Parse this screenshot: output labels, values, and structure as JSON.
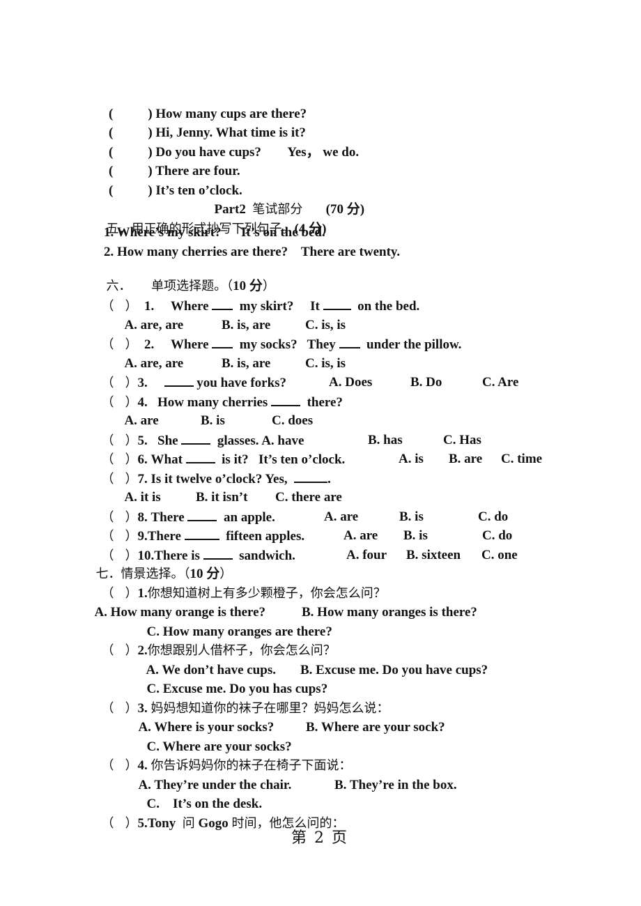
{
  "listening_tail": [
    "How many cups are there?",
    "Hi, Jenny. What time is it?",
    "Do you have cups?        Yes， we do.",
    "There are four.",
    "It’s ten o’clock."
  ],
  "part2": {
    "title": "Part2",
    "cn": "笔试部分",
    "score": "(70 分)"
  },
  "sec5": {
    "heading": "五．用正确的形式抄写下列句子。",
    "score": "(4 分)",
    "items": [
      "1. Where’s my skirt?      It’s on the bed.",
      "2. How many cherries are there?    There are twenty."
    ]
  },
  "sec6": {
    "heading": "六．     单项选择题。（",
    "score": "10 分",
    "close": "）",
    "q1": {
      "num": "1.",
      "a": "Where",
      "b": "my skirt?",
      "c": "It",
      "d": "on the bed.",
      "opts": [
        "A. are, are",
        "B. is, are",
        "C. is, is"
      ]
    },
    "q2": {
      "num": "2.",
      "a": "Where",
      "b": "my socks?",
      "c": "They",
      "d": "under the pillow.",
      "opts": [
        "A. are, are",
        "B. is, are",
        "C. is, is"
      ]
    },
    "q3": {
      "num": "3.",
      "b": "you have forks?",
      "opts": [
        "A. Does",
        "B. Do",
        "C. Are"
      ]
    },
    "q4": {
      "num": "4.",
      "a": "How many cherries",
      "b": "there?",
      "opts": [
        "A. are",
        "B. is",
        "C. does"
      ]
    },
    "q5": {
      "num": "5.",
      "a": "She",
      "b": "glasses.",
      "opts": [
        "A. have",
        "B. has",
        "C. Has"
      ]
    },
    "q6": {
      "num": "6. What",
      "b": "is it?",
      "c": "It’s ten o’clock.",
      "opts": [
        "A. is",
        "B. are",
        "C. time"
      ]
    },
    "q7": {
      "num": "7. Is it twelve o’clock? Yes,",
      "end": ".",
      "opts": [
        "A. it is",
        "B. it isn’t",
        "C. there are"
      ]
    },
    "q8": {
      "num": "8. There",
      "b": "an apple.",
      "opts": [
        "A. are",
        "B. is",
        "C. do"
      ]
    },
    "q9": {
      "num": "9.There",
      "b": "fifteen apples.",
      "opts": [
        "A. are",
        "B. is",
        "C. do"
      ]
    },
    "q10": {
      "num": "10.There is",
      "b": "sandwich.",
      "opts": [
        "A. four",
        "B. sixteen",
        "C. one"
      ]
    }
  },
  "sec7": {
    "heading": "七．情景选择。（",
    "score": "10 分",
    "close": "）",
    "q1": {
      "num": "1.",
      "prompt": "你想知道树上有多少颗橙子，你会怎么问？",
      "opts": [
        "A. How many orange is there?",
        "B. How many oranges is there?",
        "C. How many oranges are there?"
      ]
    },
    "q2": {
      "num": "2.",
      "prompt": "你想跟别人借杯子，你会怎么问？",
      "opts": [
        "A. We don’t have cups.",
        "B. Excuse me. Do you have cups?",
        "C. Excuse me. Do you has cups?"
      ]
    },
    "q3": {
      "num": "3.",
      "prompt": "妈妈想知道你的袜子在哪里？妈妈怎么说：",
      "opts": [
        "A. Where is your socks?",
        "B. Where are your sock?",
        "C. Where are your socks?"
      ]
    },
    "q4": {
      "num": "4.",
      "prompt": "你告诉妈妈你的袜子在椅子下面说：",
      "opts": [
        "A. They’re under the chair.",
        "B. They’re in the box.",
        "C.    It’s on the desk."
      ]
    },
    "q5": {
      "num": "5.Tony",
      "cn1": "问",
      "name": "Gogo",
      "cn2": "时间，他怎么问的："
    }
  },
  "footer": {
    "page_label": "第 2 页"
  },
  "paren_open": "(",
  "paren_close": ")",
  "cparen_open": "（",
  "cparen_close": "）"
}
